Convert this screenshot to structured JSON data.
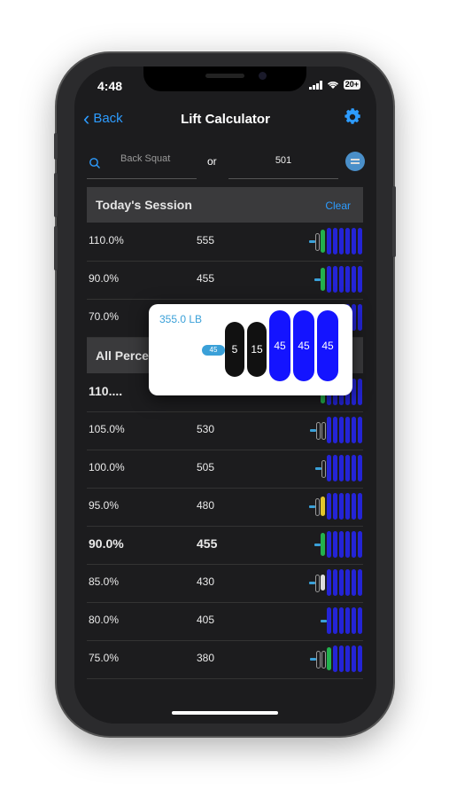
{
  "status": {
    "time": "4:48",
    "battery": "20+"
  },
  "nav": {
    "back_label": "Back",
    "title": "Lift Calculator"
  },
  "search": {
    "exercise": "Back Squat",
    "or_label": "or",
    "weight": "501"
  },
  "todays_session": {
    "header": "Today's Session",
    "clear_label": "Clear",
    "rows": [
      {
        "pct": "110.0%",
        "weight": "555",
        "plates": [
          "ring",
          "green",
          "big",
          "big",
          "big",
          "big",
          "big",
          "big"
        ]
      },
      {
        "pct": "90.0%",
        "weight": "455",
        "plates": [
          "green",
          "big",
          "big",
          "big",
          "big",
          "big",
          "big"
        ]
      },
      {
        "pct": "70.0%",
        "weight": "355",
        "plates": [
          "big",
          "big",
          "big",
          "big",
          "big",
          "big"
        ]
      }
    ]
  },
  "all_percentages": {
    "header": "All Percentages",
    "rows": [
      {
        "pct": "110....",
        "weight": "555",
        "bold": true,
        "plates": [
          "green",
          "big",
          "big",
          "big",
          "big",
          "big",
          "big"
        ]
      },
      {
        "pct": "105.0%",
        "weight": "530",
        "plates": [
          "ring",
          "ring",
          "big",
          "big",
          "big",
          "big",
          "big",
          "big"
        ]
      },
      {
        "pct": "100.0%",
        "weight": "505",
        "plates": [
          "ring",
          "big",
          "big",
          "big",
          "big",
          "big",
          "big"
        ]
      },
      {
        "pct": "95.0%",
        "weight": "480",
        "plates": [
          "ring",
          "yellow",
          "big",
          "big",
          "big",
          "big",
          "big",
          "big"
        ]
      },
      {
        "pct": "90.0%",
        "weight": "455",
        "bold": true,
        "plates": [
          "green",
          "big",
          "big",
          "big",
          "big",
          "big",
          "big"
        ]
      },
      {
        "pct": "85.0%",
        "weight": "430",
        "plates": [
          "ring",
          "white",
          "big",
          "big",
          "big",
          "big",
          "big",
          "big"
        ]
      },
      {
        "pct": "80.0%",
        "weight": "405",
        "plates": [
          "big",
          "big",
          "big",
          "big",
          "big",
          "big"
        ]
      },
      {
        "pct": "75.0%",
        "weight": "380",
        "plates": [
          "ring",
          "ring",
          "green",
          "big",
          "big",
          "big",
          "big",
          "big"
        ]
      }
    ]
  },
  "popup": {
    "total": "355.0 LB",
    "bar_label": "45",
    "plates": [
      {
        "label": "5",
        "kind": "black"
      },
      {
        "label": "15",
        "kind": "black"
      },
      {
        "label": "45",
        "kind": "blue"
      },
      {
        "label": "45",
        "kind": "blue"
      },
      {
        "label": "45",
        "kind": "blue"
      }
    ]
  },
  "colors": {
    "accent": "#2d9cff",
    "plate_blue": "#2424d6",
    "plate_green": "#23b14d",
    "plate_yellow": "#e3c62c"
  }
}
